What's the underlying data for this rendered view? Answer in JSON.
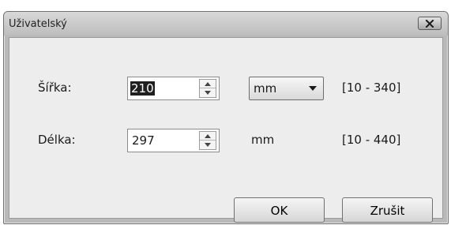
{
  "window": {
    "title": "Uživatelský"
  },
  "width": {
    "label": "Šířka:",
    "value": "210",
    "unit_select": "mm",
    "range": "[10 - 340]"
  },
  "length": {
    "label": "Délka:",
    "value": "297",
    "unit": "mm",
    "range": "[10 - 440]"
  },
  "buttons": {
    "ok": "OK",
    "cancel": "Zrušit"
  },
  "icons": {
    "close": "close-icon",
    "spin_up": "arrow-up-icon",
    "spin_down": "arrow-down-icon",
    "dropdown": "chevron-down-icon"
  }
}
